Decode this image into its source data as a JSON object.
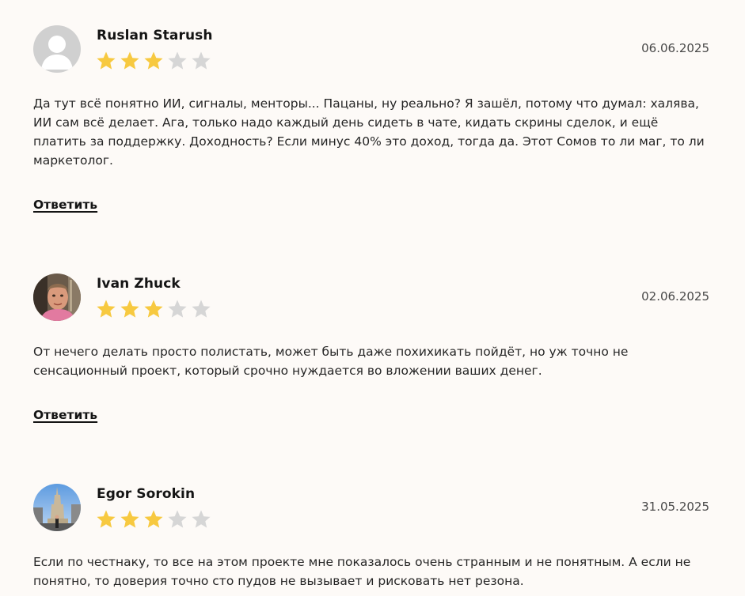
{
  "colors": {
    "background": "#fdfaf7",
    "star_filled": "#f7c940",
    "star_empty": "#d6d6d6"
  },
  "reviews": [
    {
      "author": "Ruslan Starush",
      "avatar_icon": "default-user-avatar",
      "rating": 3,
      "max_rating": 5,
      "date": "06.06.2025",
      "text": "Да тут всё понятно ИИ, сигналы, менторы... Пацаны, ну реально? Я зашёл, потому что думал: халява, ИИ сам всё делает. Ага, только надо каждый день сидеть в чате, кидать скрины сделок, и ещё платить за поддержку. Доходность? Если минус 40% это доход, тогда да. Этот Сомов то ли маг, то ли маркетолог.",
      "reply_label": "Ответить"
    },
    {
      "author": "Ivan Zhuck",
      "avatar_icon": "user-photo-avatar",
      "rating": 3,
      "max_rating": 5,
      "date": "02.06.2025",
      "text": "От нечего делать просто полистать, может быть даже похихикать пойдёт, но уж точно не сенсационный проект, который срочно нуждается во вложении ваших денег.",
      "reply_label": "Ответить"
    },
    {
      "author": "Egor Sorokin",
      "avatar_icon": "user-photo-avatar",
      "rating": 3,
      "max_rating": 5,
      "date": "31.05.2025",
      "text": "Если по честнаку, то все на этом проекте мне показалось очень странным и не понятным. А если не понятно, то доверия точно сто пудов не вызывает и рисковать нет резона."
    }
  ]
}
